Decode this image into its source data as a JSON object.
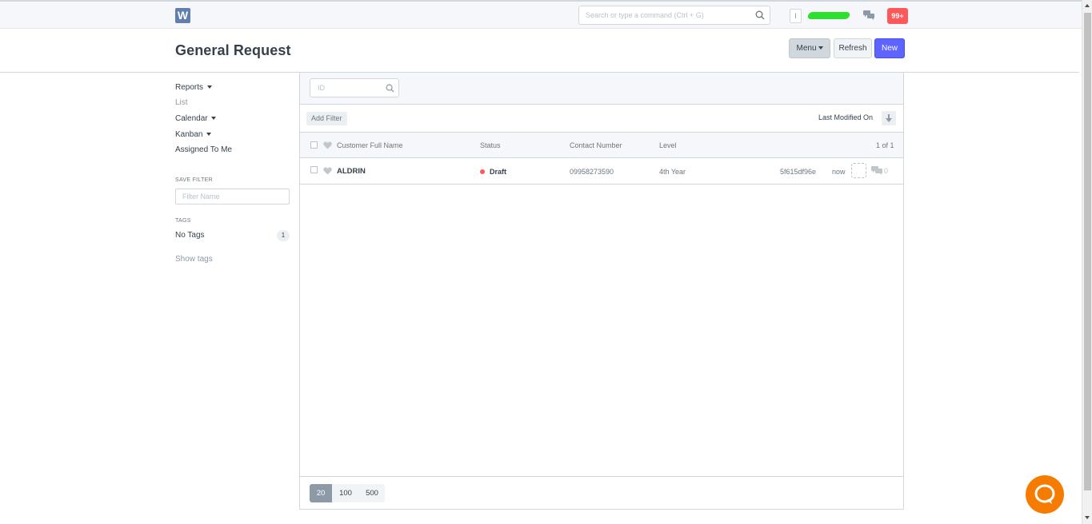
{
  "navbar": {
    "logo_letter": "W",
    "search_placeholder": "Search or type a command (Ctrl + G)",
    "avatar_letter": "I",
    "notifications_badge": "99+",
    "accent_color": "#5e64ff",
    "icons": [
      "search-icon",
      "chat-icon"
    ]
  },
  "page": {
    "title": "General Request",
    "menu_label": "Menu",
    "refresh_label": "Refresh",
    "new_label": "New"
  },
  "sidebar": {
    "reports": "Reports",
    "list": "List",
    "calendar": "Calendar",
    "kanban": "Kanban",
    "assigned_to_me": "Assigned To Me",
    "save_filter_label": "SAVE FILTER",
    "filter_name_placeholder": "Filter Name",
    "tags_label": "TAGS",
    "no_tags": "No Tags",
    "no_tags_count": "1",
    "show_tags": "Show tags"
  },
  "list": {
    "id_placeholder": "ID",
    "add_filter": "Add Filter",
    "sort_label": "Last Modified On",
    "columns": {
      "name": "Customer Full Name",
      "status": "Status",
      "contact": "Contact Number",
      "level": "Level"
    },
    "count_label": "1 of 1",
    "rows": [
      {
        "name": "ALDRIN",
        "status": "Draft",
        "status_color": "#ff5858",
        "contact": "09958273590",
        "level": "4th Year",
        "id": "5f615df96e",
        "modified": "now",
        "comments": "0"
      }
    ],
    "page_sizes": [
      "20",
      "100",
      "500"
    ],
    "active_page_size": "20"
  }
}
